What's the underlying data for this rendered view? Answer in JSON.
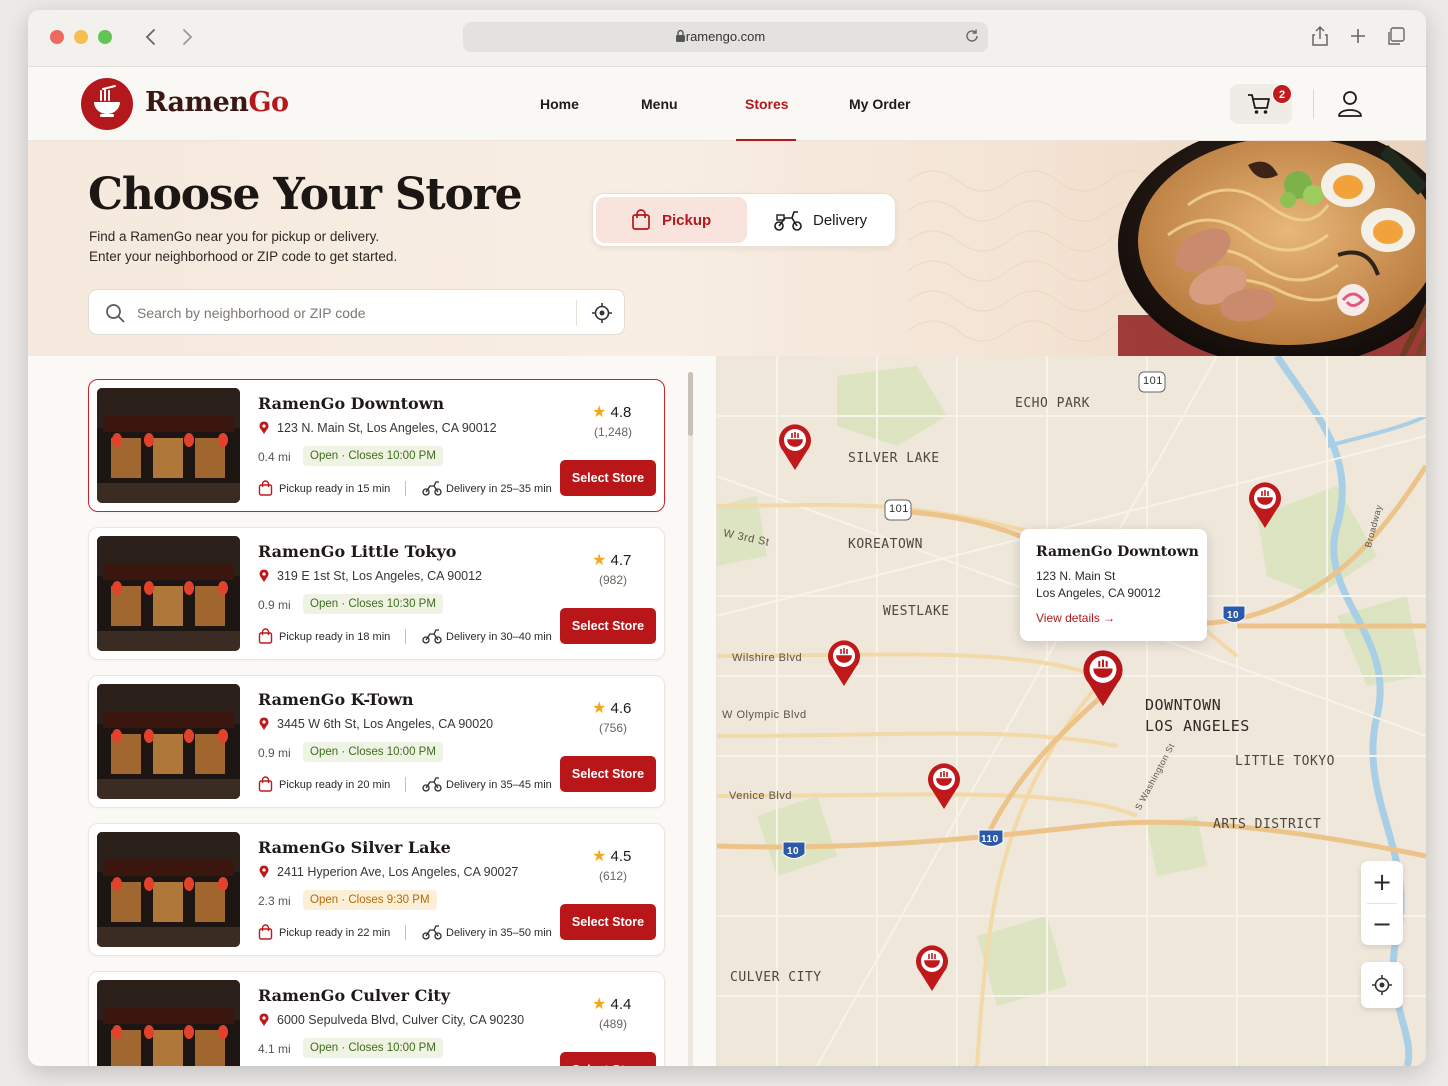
{
  "browser": {
    "url": "ramengo.com"
  },
  "brand": {
    "name_part1": "Ramen",
    "name_part2": "Go",
    "accent": "#b3191c"
  },
  "nav": {
    "items": [
      "Home",
      "Menu",
      "Stores",
      "My Order"
    ],
    "active": "Stores"
  },
  "cart": {
    "count": "2"
  },
  "hero": {
    "title": "Choose Your Store",
    "subtitle_line1": "Find a RamenGo near you for pickup or delivery.",
    "subtitle_line2": "Enter your neighborhood or ZIP code to get started.",
    "search_placeholder": "Search by neighborhood or ZIP code",
    "mode_pickup": "Pickup",
    "mode_delivery": "Delivery",
    "selected_mode": "Pickup"
  },
  "stores": [
    {
      "name": "RamenGo Downtown",
      "address": "123 N. Main St, Los Angeles, CA 90012",
      "distance": "0.4 mi",
      "status": "Open · Closes 10:00 PM",
      "status_kind": "open",
      "pickup": "Pickup ready in 15 min",
      "delivery": "Delivery in 25–35 min",
      "rating": "4.8",
      "reviews": "(1,248)",
      "button": "Select Store",
      "selected": true
    },
    {
      "name": "RamenGo Little Tokyo",
      "address": "319 E 1st St, Los Angeles, CA 90012",
      "distance": "0.9 mi",
      "status": "Open · Closes 10:30 PM",
      "status_kind": "open",
      "pickup": "Pickup ready in 18 min",
      "delivery": "Delivery in 30–40 min",
      "rating": "4.7",
      "reviews": "(982)",
      "button": "Select Store",
      "selected": false
    },
    {
      "name": "RamenGo K-Town",
      "address": "3445 W 6th St, Los Angeles, CA 90020",
      "distance": "0.9 mi",
      "status": "Open · Closes 10:00 PM",
      "status_kind": "open",
      "pickup": "Pickup ready in 20 min",
      "delivery": "Delivery in 35–45 min",
      "rating": "4.6",
      "reviews": "(756)",
      "button": "Select Store",
      "selected": false
    },
    {
      "name": "RamenGo Silver Lake",
      "address": "2411 Hyperion Ave, Los Angeles, CA 90027",
      "distance": "2.3 mi",
      "status": "Open · Closes 9:30 PM",
      "status_kind": "warn",
      "pickup": "Pickup ready in 22 min",
      "delivery": "Delivery in 35–50 min",
      "rating": "4.5",
      "reviews": "(612)",
      "button": "Select Store",
      "selected": false
    },
    {
      "name": "RamenGo Culver City",
      "address": "6000 Sepulveda Blvd, Culver City, CA 90230",
      "distance": "4.1 mi",
      "status": "Open · Closes 10:00 PM",
      "status_kind": "open",
      "pickup": "",
      "delivery": "",
      "rating": "4.4",
      "reviews": "(489)",
      "button": "Select Store",
      "selected": false
    }
  ],
  "storefront_signs": [
    "RamenGo",
    "RAMENGO",
    "RAMENGO",
    "RAMENGO",
    "RAMENGO"
  ],
  "map": {
    "neighborhoods": {
      "echo_park": "ECHO PARK",
      "silver_lake": "SILVER LAKE",
      "koreatown": "KOREATOWN",
      "westlake": "WESTLAKE",
      "downtown_1": "DOWNTOWN",
      "downtown_2": "LOS ANGELES",
      "little_tokyo": "LITTLE TOKYO",
      "arts_district": "ARTS DISTRICT",
      "culver_city": "CULVER CITY"
    },
    "streets": {
      "w3rd": "W 3rd St",
      "wilshire": "Wilshire Blvd",
      "olympic": "W Olympic Blvd",
      "venice": "Venice Blvd",
      "s_washington": "S Washington St",
      "broadway": "Broadway"
    },
    "shields": {
      "us101_top": "101",
      "us101_mid": "101",
      "i10_east": "10",
      "i110": "110",
      "i10_west": "10"
    },
    "popup": {
      "title": "RamenGo Downtown",
      "address_line1": "123 N. Main St",
      "address_line2": "Los Angeles, CA 90012",
      "link": "View details"
    },
    "zoom_in": "+",
    "zoom_out": "−"
  }
}
